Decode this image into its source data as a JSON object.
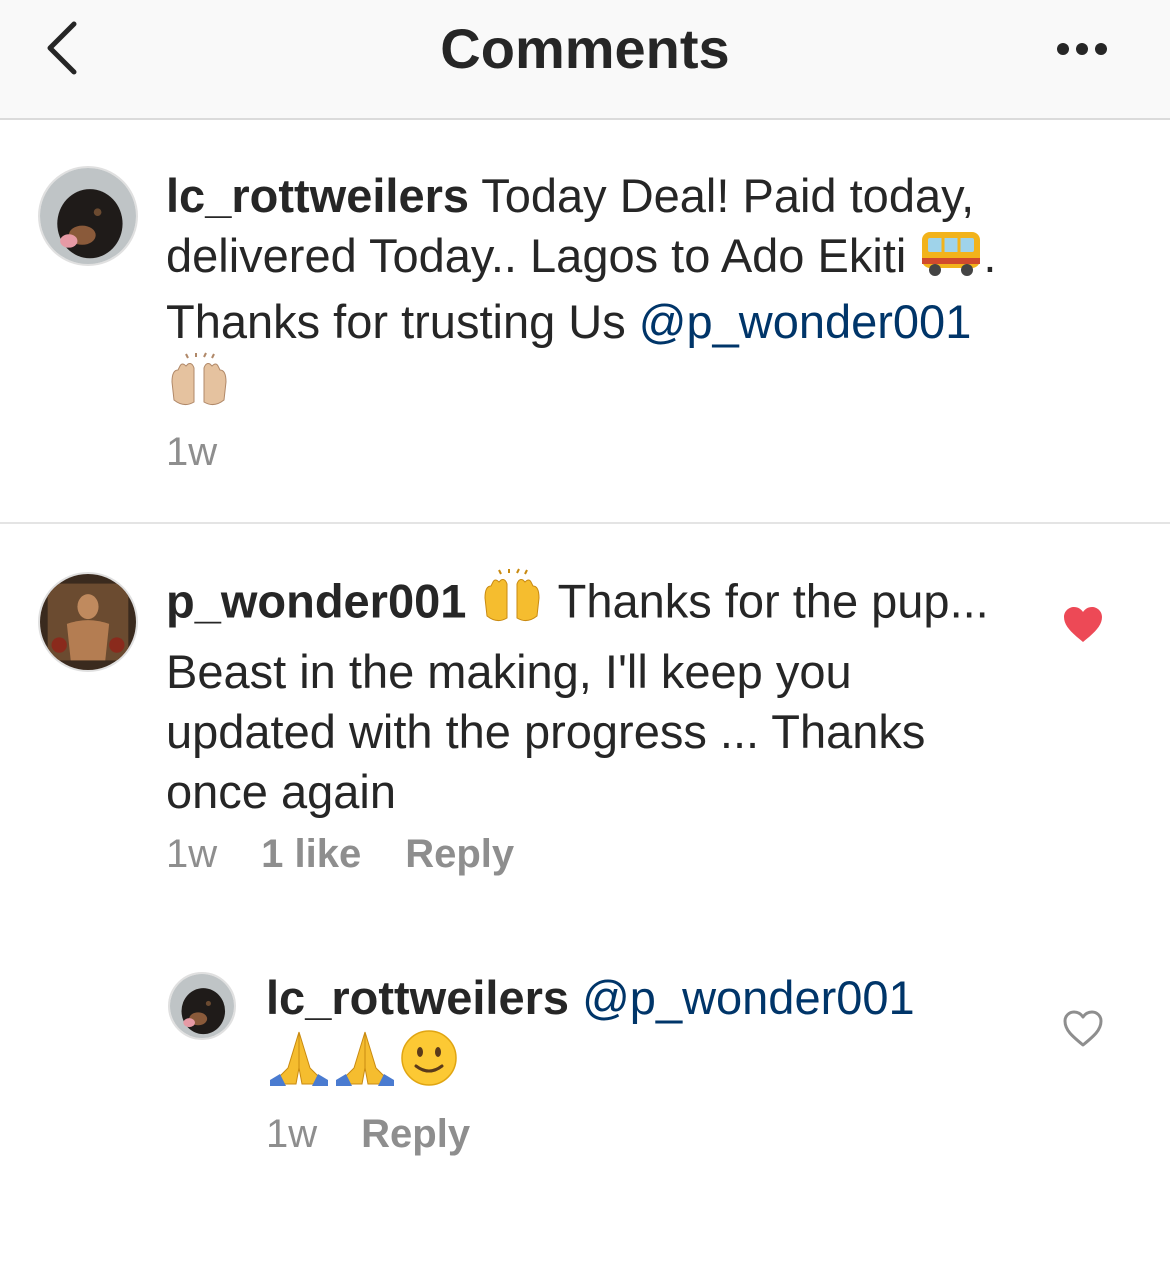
{
  "header": {
    "title": "Comments"
  },
  "comments": [
    {
      "username": "lc_rottweilers",
      "text_1": " Today Deal!  Paid today, delivered Today.. Lagos to Ado Ekiti ",
      "text_2": ". Thanks for trusting Us ",
      "mention": "@p_wonder001",
      "emoji_1": "bus-emoji",
      "emoji_2": "raising-hands-light-emoji",
      "time": "1w"
    },
    {
      "username": "p_wonder001",
      "emoji_1": "raising-hands-emoji",
      "text": " Thanks for the pup... Beast in the making, I'll keep you updated with the progress ... Thanks once again",
      "time": "1w",
      "likes": "1 like",
      "reply_label": "Reply",
      "liked": true,
      "like_color": "#ed4956"
    },
    {
      "username": "lc_rottweilers",
      "mention": "@p_wonder001",
      "emojis": [
        "folded-hands-emoji",
        "folded-hands-emoji",
        "slightly-smiling-face-emoji"
      ],
      "time": "1w",
      "reply_label": "Reply",
      "liked": false
    }
  ],
  "colors": {
    "mention": "#003569",
    "meta": "#8e8e8e",
    "like": "#ed4956"
  }
}
